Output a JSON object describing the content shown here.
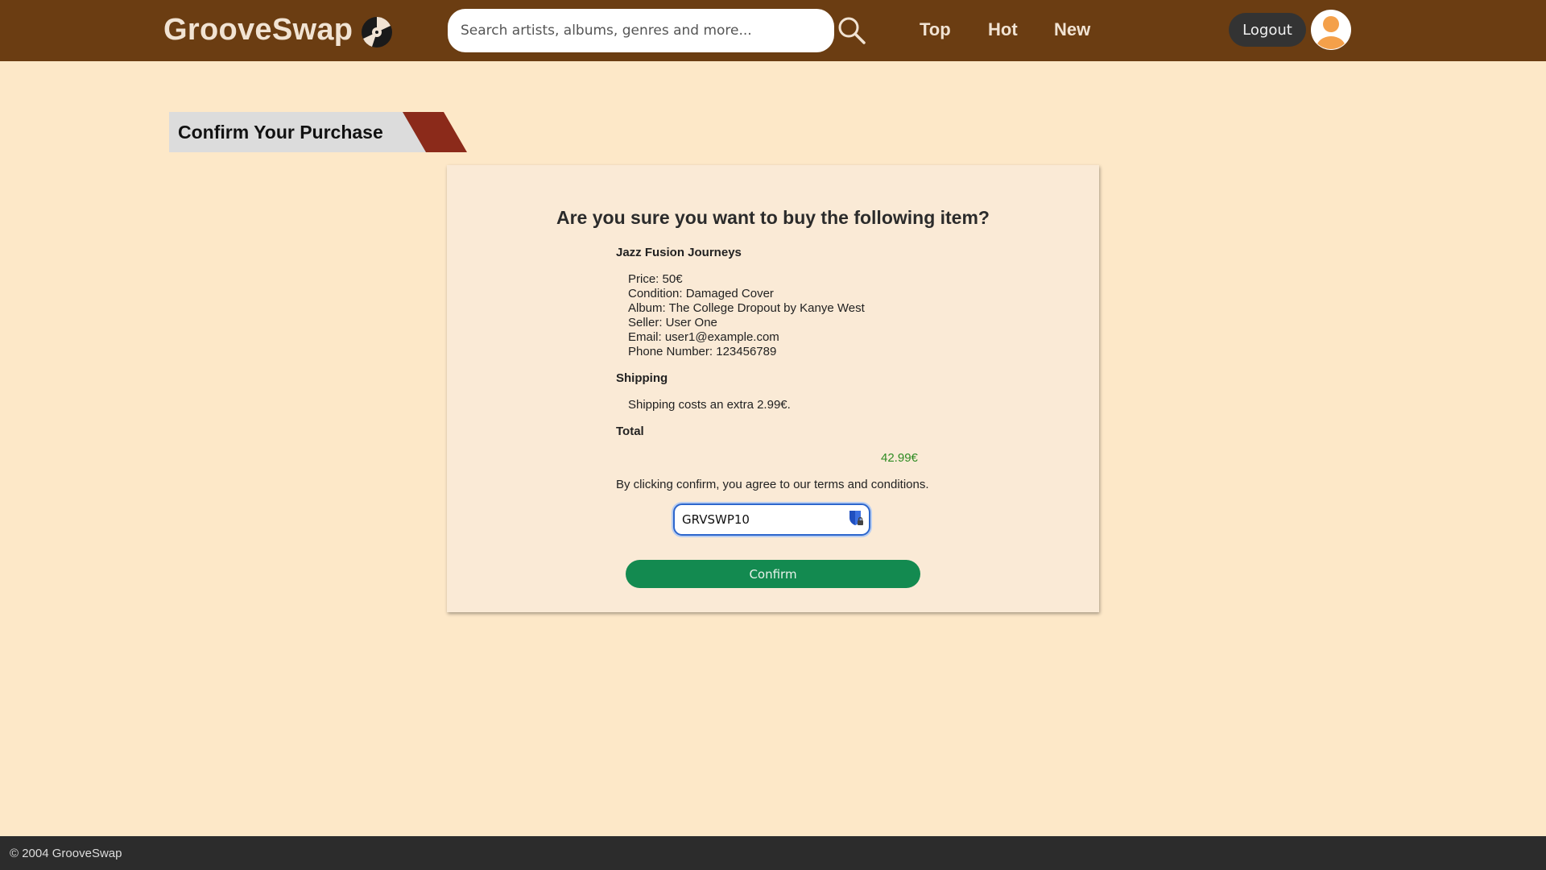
{
  "header": {
    "brand": "GrooveSwap",
    "search_placeholder": "Search artists, albums, genres and more...",
    "nav": [
      "Top",
      "Hot",
      "New"
    ],
    "logout_label": "Logout"
  },
  "page": {
    "title": "Confirm Your Purchase"
  },
  "purchase": {
    "question": "Are you sure you want to buy the following item?",
    "item_name": "Jazz Fusion Journeys",
    "details": [
      "Price: 50€",
      "Condition: Damaged Cover",
      "Album: The College Dropout by Kanye West",
      "Seller: User One",
      "Email: user1@example.com",
      "Phone Number: 123456789"
    ],
    "shipping_label": "Shipping",
    "shipping_text": "Shipping costs an extra 2.99€.",
    "total_label": "Total",
    "total_value": "42.99€",
    "terms_text": "By clicking confirm, you agree to our terms and conditions.",
    "coupon_value": "GRVSWP10",
    "confirm_label": "Confirm"
  },
  "footer": {
    "text": "© 2004 GrooveSwap"
  },
  "colors": {
    "header_bg": "#6b3d12",
    "page_bg": "#fde8c8",
    "card_bg": "#faead6",
    "confirm_bg": "#138a50",
    "total_green": "#2e8b22",
    "accent_red": "#8b2a1a"
  },
  "icons": [
    "vinyl-record-icon",
    "search-icon",
    "user-avatar-icon",
    "shield-lock-icon"
  ]
}
